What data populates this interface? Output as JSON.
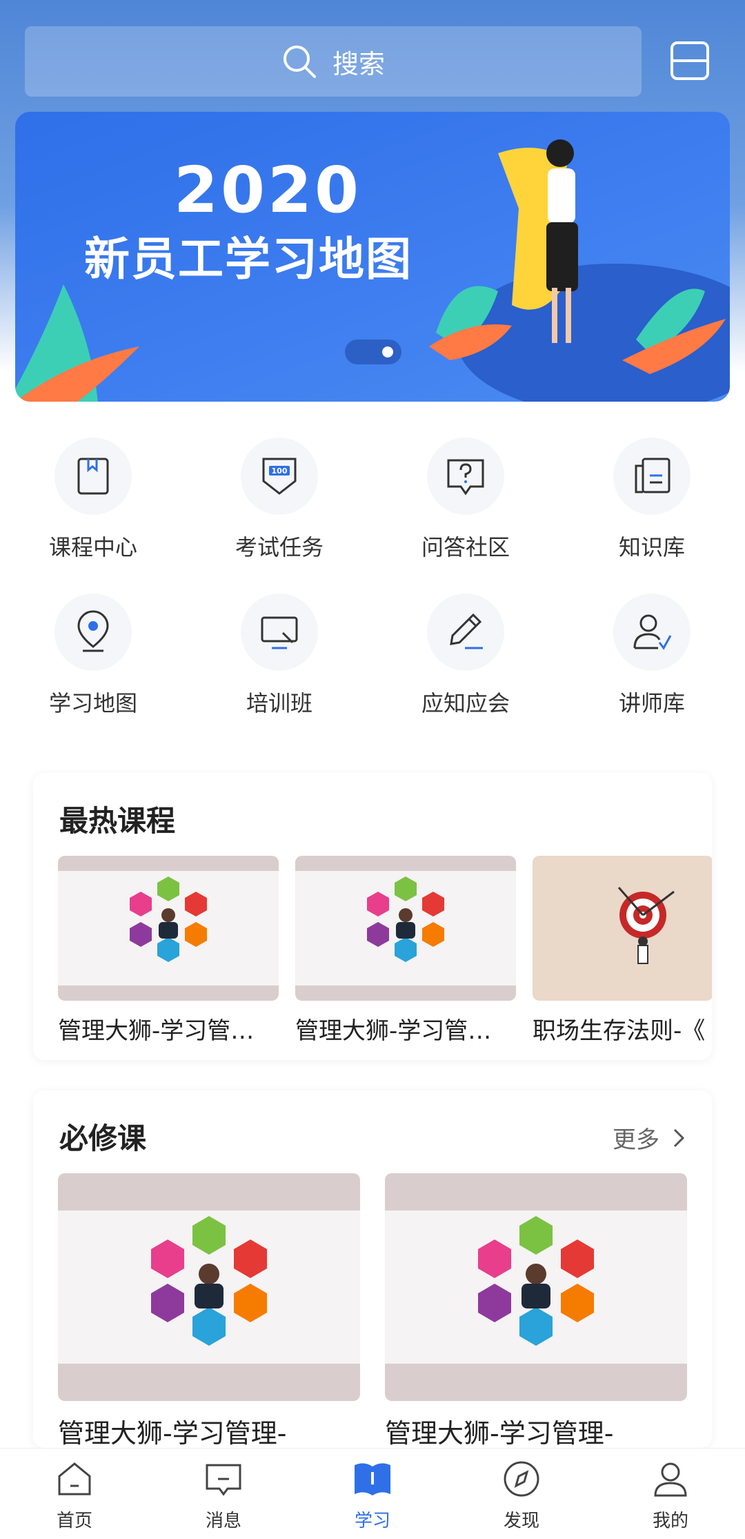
{
  "search": {
    "placeholder": "搜索"
  },
  "banner": {
    "year": "2020",
    "title": "新员工学习地图"
  },
  "quick_menu": [
    {
      "label": "课程中心",
      "icon": "book-icon"
    },
    {
      "label": "考试任务",
      "icon": "exam-badge-icon"
    },
    {
      "label": "问答社区",
      "icon": "question-chat-icon"
    },
    {
      "label": "知识库",
      "icon": "document-icon"
    },
    {
      "label": "学习地图",
      "icon": "location-pin-icon"
    },
    {
      "label": "培训班",
      "icon": "monitor-icon"
    },
    {
      "label": "应知应会",
      "icon": "pencil-icon"
    },
    {
      "label": "讲师库",
      "icon": "teacher-icon"
    }
  ],
  "hot_courses": {
    "title": "最热课程",
    "items": [
      {
        "title": "管理大狮-学习管…"
      },
      {
        "title": "管理大狮-学习管…"
      },
      {
        "title": "职场生存法则-《"
      }
    ]
  },
  "required_courses": {
    "title": "必修课",
    "more_label": "更多",
    "items": [
      {
        "title": "管理大狮-学习管理-"
      },
      {
        "title": "管理大狮-学习管理-"
      }
    ]
  },
  "tabbar": [
    {
      "label": "首页",
      "icon": "home-icon",
      "active": false
    },
    {
      "label": "消息",
      "icon": "message-icon",
      "active": false
    },
    {
      "label": "学习",
      "icon": "study-book-icon",
      "active": true
    },
    {
      "label": "发现",
      "icon": "compass-icon",
      "active": false
    },
    {
      "label": "我的",
      "icon": "user-icon",
      "active": false
    }
  ],
  "colors": {
    "brand": "#2f6fe8",
    "accent": "#4f86d6"
  }
}
